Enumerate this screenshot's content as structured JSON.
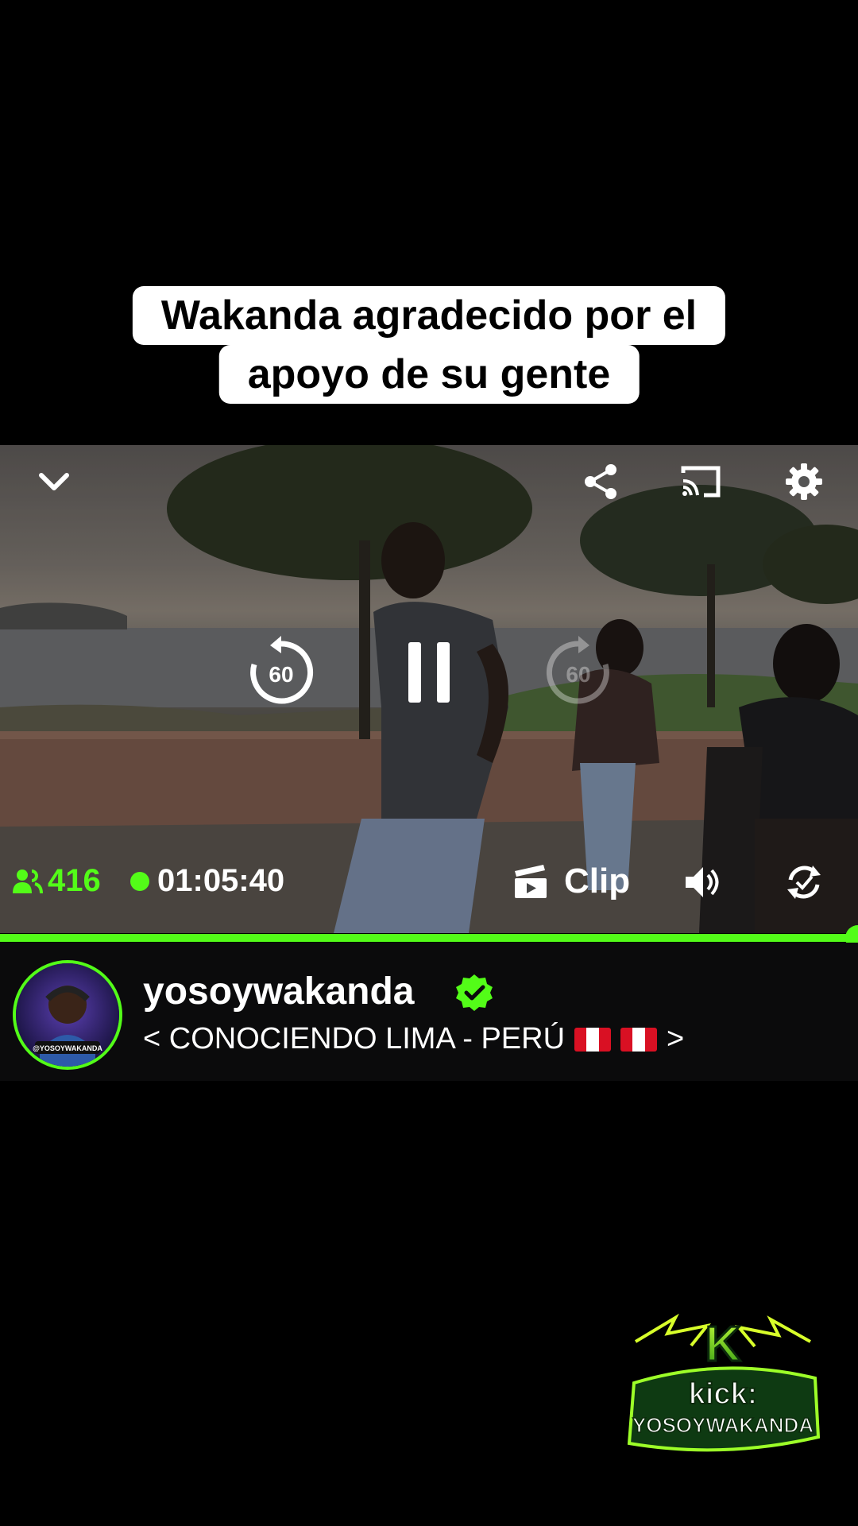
{
  "caption": {
    "line1": "Wakanda agradecido por el",
    "line2": "apoyo de su gente"
  },
  "player": {
    "rewind_label": "60",
    "forward_label": "60",
    "viewer_count": "416",
    "uptime": "01:05:40",
    "clip_label": "Clip",
    "progress": 1.0
  },
  "channel": {
    "username": "yosoywakanda",
    "title_prefix": "< CONOCIENDO LIMA - PERÚ",
    "title_suffix": ">",
    "avatar_text": "@YOSOYWAKANDA"
  },
  "watermark": {
    "letter": "K",
    "line1": "kick:",
    "line2": "YOSOYWAKANDA"
  },
  "colors": {
    "accent": "#53fc18",
    "background": "#000000",
    "info_bar": "#0b0b0c"
  },
  "icons": [
    "chevron-down-icon",
    "share-icon",
    "cast-icon",
    "gear-icon",
    "rewind-60-icon",
    "pause-icon",
    "forward-60-icon",
    "viewers-icon",
    "live-dot-icon",
    "clip-icon",
    "volume-icon",
    "rotate-icon",
    "verified-icon",
    "peru-flag-icon"
  ]
}
